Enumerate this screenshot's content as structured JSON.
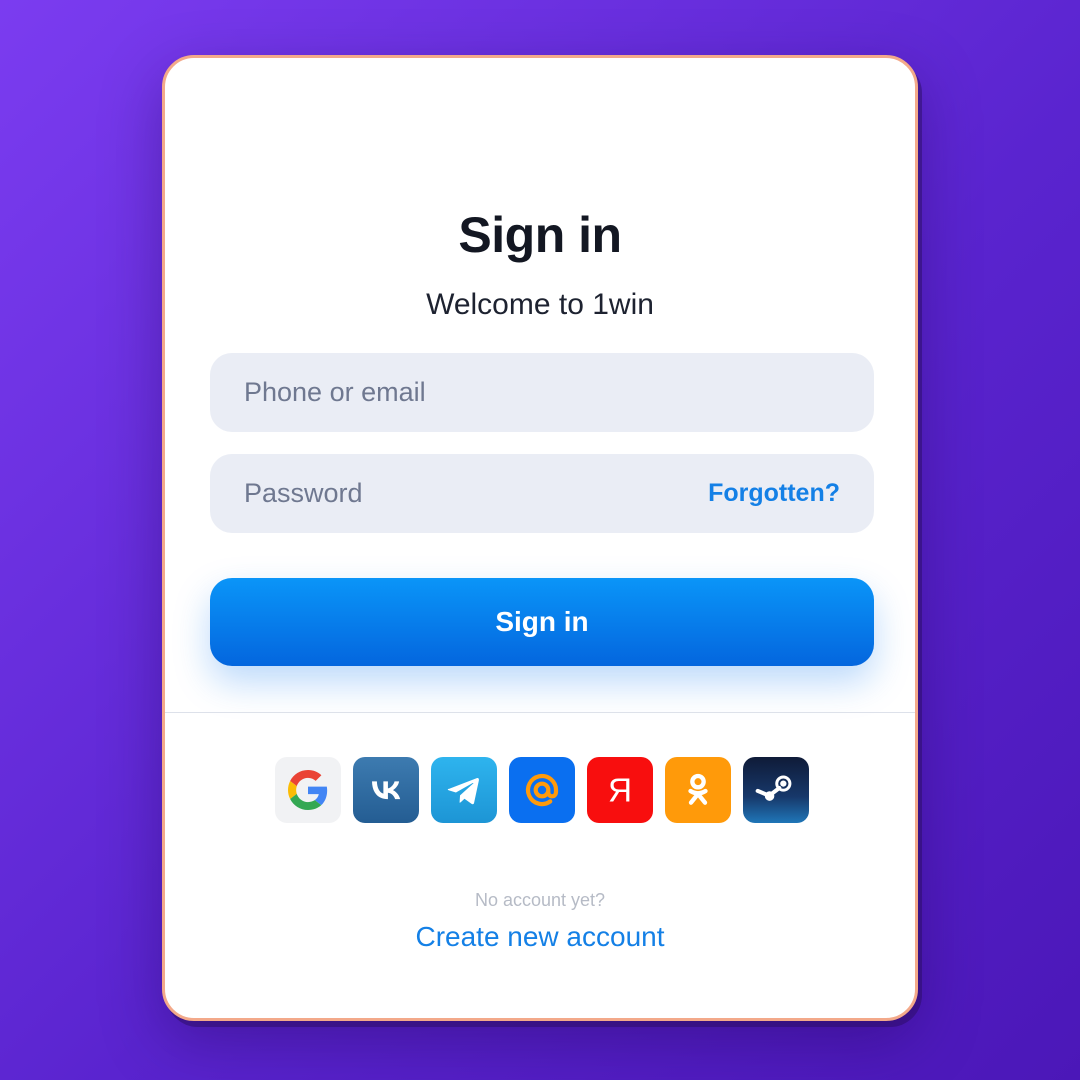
{
  "signin": {
    "title": "Sign in",
    "subtitle": "Welcome to 1win",
    "phone_placeholder": "Phone or email",
    "password_placeholder": "Password",
    "forgot_label": "Forgotten?",
    "submit_label": "Sign in"
  },
  "social": [
    {
      "name": "google-icon",
      "color": "#f1f2f4"
    },
    {
      "name": "vk-icon",
      "color": "#2f6ea5"
    },
    {
      "name": "telegram-icon",
      "color": "#27a7e7"
    },
    {
      "name": "mail-ru-icon",
      "color": "#0a6ff0"
    },
    {
      "name": "yandex-icon",
      "color": "#f80e0e"
    },
    {
      "name": "odnoklassniki-icon",
      "color": "#ff9a0a"
    },
    {
      "name": "steam-icon",
      "color": "#17386a"
    }
  ],
  "footer": {
    "no_account": "No account yet?",
    "create_link": "Create new account"
  },
  "colors": {
    "accent": "#1480e6",
    "background": "#6a2fe0",
    "field_bg": "#eaedf5"
  }
}
